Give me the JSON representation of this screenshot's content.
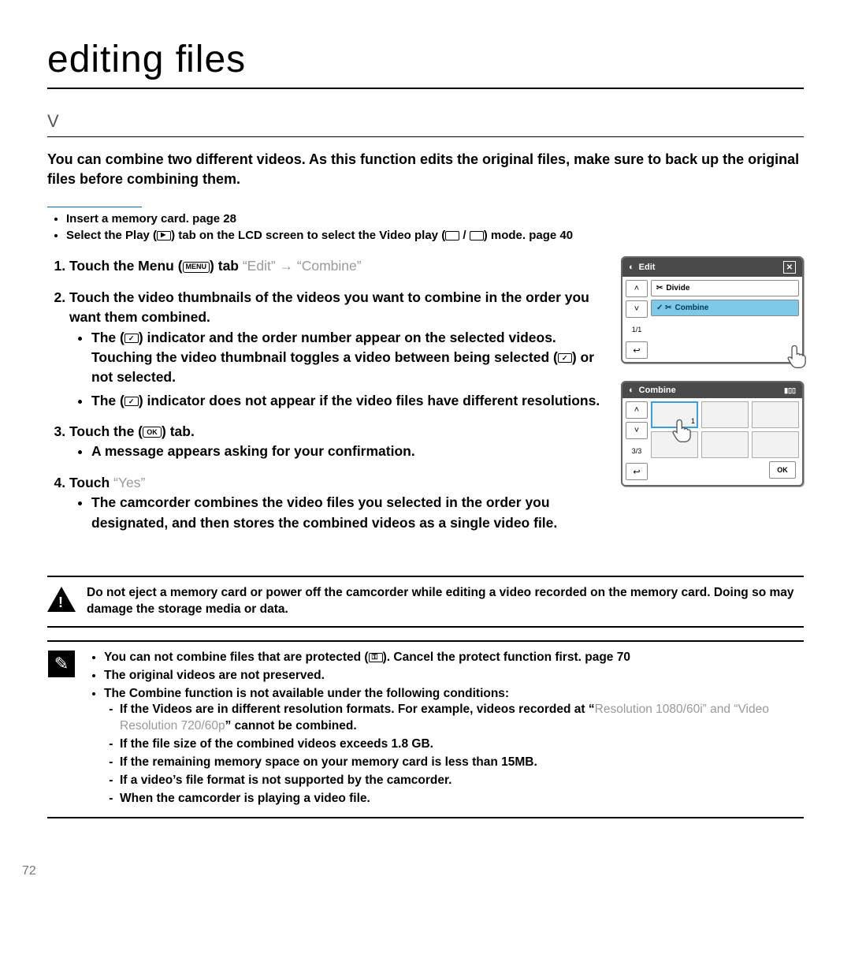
{
  "chapter_title": "editing ﬁles",
  "section_title": "V",
  "intro": "You can combine two different videos. As this function edits the original files, make sure to back up the original files before combining them.",
  "precheck": [
    {
      "pre": "Insert a memory card. ",
      "ref": "page 28"
    },
    {
      "pre": "Select the Play (",
      "icon": "play",
      "mid": ") tab on the LCD screen to select the Video play (",
      "mid2": " / ",
      "post": ") mode.   ",
      "ref": "page 40"
    }
  ],
  "step1": {
    "a": "Touch the Menu (",
    "b": ") tab ",
    "c": "“Edit”",
    "d": " → ",
    "e": "“Combine”"
  },
  "step2": {
    "lead": "Touch the video thumbnails of the videos you want to combine in the order you want them combined.",
    "b1a": "The (",
    "b1b": ") indicator and the order number appear on the selected videos. Touching the video thumbnail toggles a video between being selected (",
    "b1c": ") or not selected.",
    "b2a": "The (",
    "b2b": ") indicator does not appear if the video files have different resolutions."
  },
  "step3": {
    "a": "Touch the (",
    "b": ") tab.",
    "bullet": "A message appears asking for your confirmation."
  },
  "step4": {
    "a": "Touch ",
    "b": "“Yes”",
    "bullet": "The camcorder combines the video files you selected in the order you designated, and then stores the combined videos as a single video file."
  },
  "mock1": {
    "title": "Edit",
    "row1": "Divide",
    "row2": "Combine",
    "side_count": "1/1"
  },
  "mock2": {
    "title": "Combine",
    "side_count": "3/3",
    "ok": "OK"
  },
  "warn_text": "Do not eject a memory card or power off the camcorder while editing a video recorded on the memory card. Doing so may damage the storage media or data.",
  "note": {
    "n1a": "You can not combine files that are protected (",
    "n1b": "). Cancel the protect function first. ",
    "n1c": "page 70",
    "n2": "The original videos are not preserved.",
    "n3": "The Combine function is not available under the following conditions:",
    "n3a_1": "If the Videos are in different resolution formats. For example, videos recorded at “",
    "n3a_2": "Resolution 1080/60i” and “Video Resolution 720/60p",
    "n3a_3": "” cannot be combined.",
    "n3b": "If the file size of the combined videos exceeds 1.8 GB.",
    "n3c": "If the remaining memory space on your memory card is less than 15MB.",
    "n3d": "If a video’s file format is not supported by the camcorder.",
    "n3e": "When the camcorder is playing a video file."
  },
  "page_number": "72",
  "icons": {
    "menu": "MENU",
    "ok": "OK"
  }
}
